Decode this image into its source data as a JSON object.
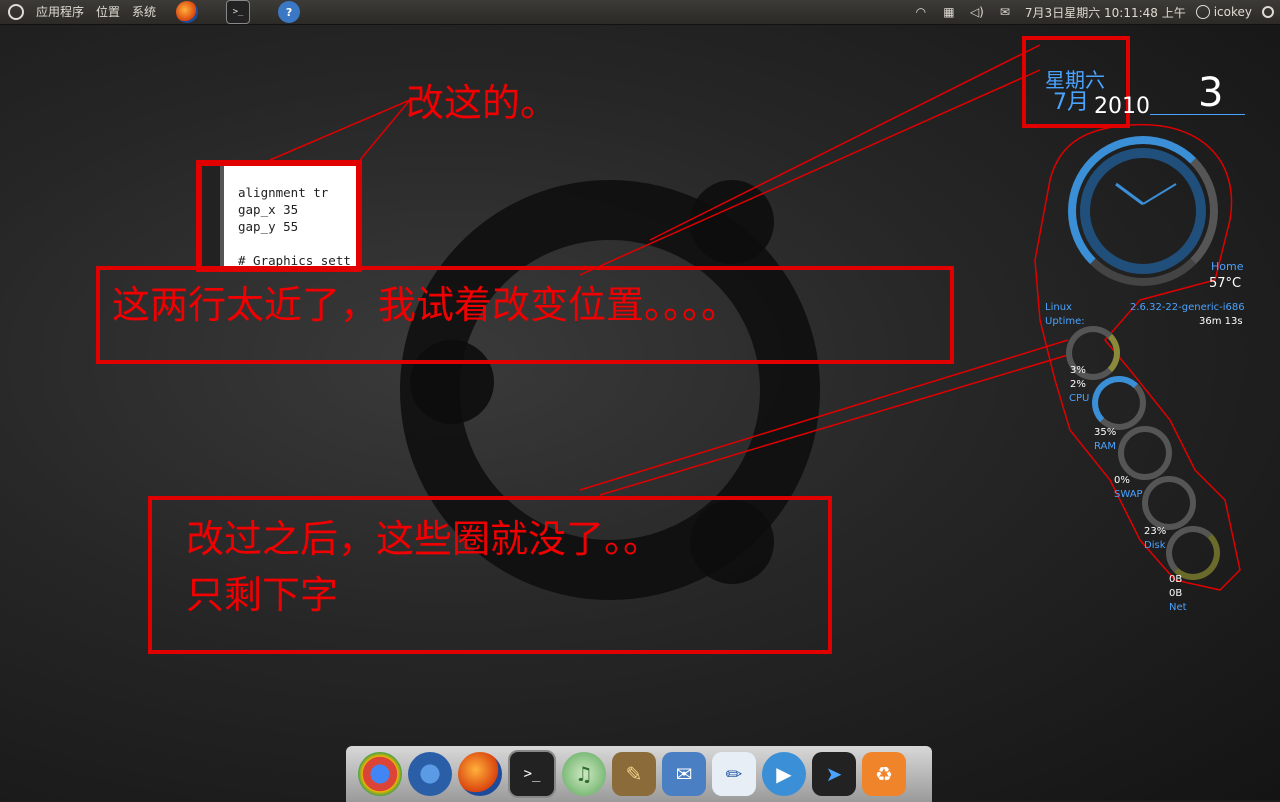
{
  "top_panel": {
    "menus": [
      "应用程序",
      "位置",
      "系统"
    ],
    "datetime": "7月3日星期六 10:11:48 上午",
    "username": "icokey"
  },
  "editor": {
    "lines": [
      "alignment tr",
      "gap_x 35",
      "gap_y 55",
      "",
      "# Graphics sett"
    ]
  },
  "annotations": {
    "a1": "改这的。",
    "a2": "这两行太近了，我试着改变位置。。。。",
    "a3_line1": "改过之后，这些圈就没了。。",
    "a3_line2": "只剩下字"
  },
  "conky": {
    "weekday": "星期六",
    "month": "7月",
    "year": "2010",
    "day": "3",
    "home_label": "Home",
    "temperature": "57°C",
    "os_label": "Linux",
    "kernel": "2.6.32-22-generic-i686",
    "uptime_label": "Uptime:",
    "uptime": "36m 13s",
    "cpu1": "3%",
    "cpu2": "2%",
    "cpu_label": "CPU",
    "ram": "35%",
    "ram_label": "RAM",
    "swap": "0%",
    "swap_label": "SWAP",
    "disk": "23%",
    "disk_label": "Disk",
    "net_down": "0B",
    "net_up": "0B",
    "net_label": "Net"
  },
  "colors": {
    "annotation_red": "#e00000",
    "conky_blue": "#4aa3ff"
  },
  "dock_icons": [
    "chrome-icon",
    "chromium-icon",
    "firefox-icon",
    "terminal-icon",
    "music-icon",
    "gimp-icon",
    "mail-icon",
    "text-editor-icon",
    "chat-icon",
    "cursor-icon",
    "trash-icon"
  ]
}
